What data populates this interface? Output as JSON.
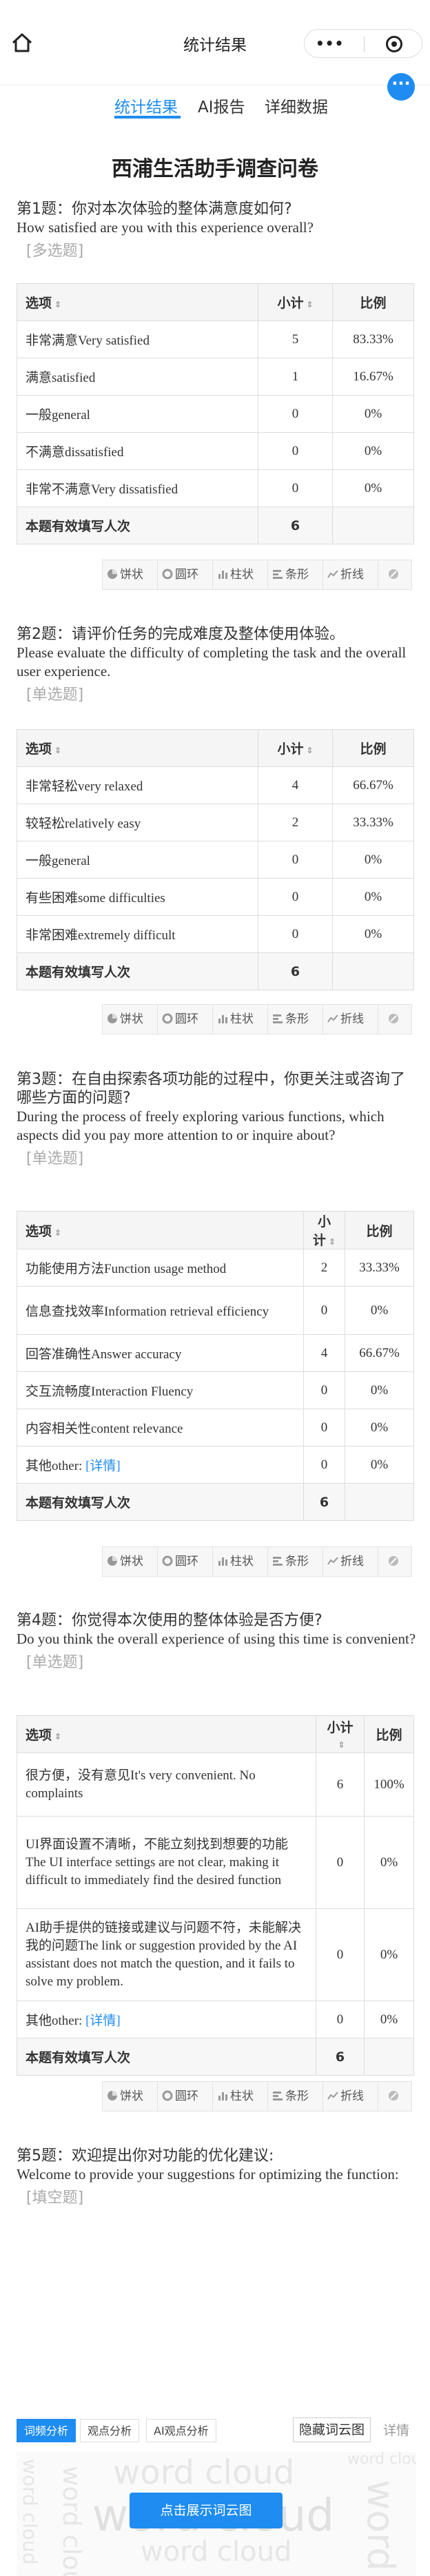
{
  "window": {
    "title": "统计结果",
    "capsule_menu": "•••",
    "capsule_close_icon": "record-icon"
  },
  "tabs": [
    {
      "label": "统计结果",
      "active": true
    },
    {
      "label": "AI报告"
    },
    {
      "label": "详细数据"
    }
  ],
  "accent": "#1e8cf0",
  "survey_title": "西浦生活助手调查问卷",
  "table_headers": {
    "option": "选项",
    "count": "小计",
    "ratio": "比例"
  },
  "total_label": "本题有效填写人次",
  "chart_tools": [
    "饼状",
    "圆环",
    "柱状",
    "条形",
    "折线"
  ],
  "questions": [
    {
      "title": "第1题：你对本次体验的整体满意度如何?",
      "title_en": "How satisfied are you with this experience overall?",
      "type": "[多选题]",
      "rows": [
        {
          "option": "非常满意Very satisfied",
          "count": "5",
          "ratio": "83.33%"
        },
        {
          "option": "满意satisfied",
          "count": "1",
          "ratio": "16.67%"
        },
        {
          "option": "一般general",
          "count": "0",
          "ratio": "0%"
        },
        {
          "option": "不满意dissatisfied",
          "count": "0",
          "ratio": "0%"
        },
        {
          "option": "非常不满意Very dissatisfied",
          "count": "0",
          "ratio": "0%"
        }
      ],
      "total": "6"
    },
    {
      "title": "第2题：请评价任务的完成难度及整体使用体验。",
      "title_en": "Please evaluate the difficulty of completing the task and the overall user experience.",
      "type": "[单选题]",
      "rows": [
        {
          "option": "非常轻松very relaxed",
          "count": "4",
          "ratio": "66.67%"
        },
        {
          "option": "较轻松relatively easy",
          "count": "2",
          "ratio": "33.33%"
        },
        {
          "option": "一般general",
          "count": "0",
          "ratio": "0%"
        },
        {
          "option": "有些困难some difficulties",
          "count": "0",
          "ratio": "0%"
        },
        {
          "option": "非常困难extremely difficult",
          "count": "0",
          "ratio": "0%"
        }
      ],
      "total": "6"
    },
    {
      "title": "第3题：在自由探索各项功能的过程中，你更关注或咨询了哪些方面的问题?",
      "title_en": "During the process of freely exploring various functions, which aspects did you pay more attention to or inquire about?",
      "type": "[单选题]",
      "rows": [
        {
          "option": "功能使用方法Function usage method",
          "count": "2",
          "ratio": "33.33%"
        },
        {
          "option": "信息查找效率Information retrieval efficiency",
          "count": "0",
          "ratio": "0%"
        },
        {
          "option": "回答准确性Answer accuracy",
          "count": "4",
          "ratio": "66.67%"
        },
        {
          "option": "交互流畅度Interaction Fluency",
          "count": "0",
          "ratio": "0%"
        },
        {
          "option": "内容相关性content relevance",
          "count": "0",
          "ratio": "0%"
        },
        {
          "option": "其他other:",
          "link": "[详情]",
          "count": "0",
          "ratio": "0%"
        }
      ],
      "total": "6"
    },
    {
      "title": "第4题：你觉得本次使用的整体体验是否方便?",
      "title_en": "Do you think the overall experience of using this time is convenient?",
      "type": "[单选题]",
      "rows": [
        {
          "option": "很方便，没有意见It's very convenient. No complaints",
          "count": "6",
          "ratio": "100%"
        },
        {
          "option": "UI界面设置不清晰，不能立刻找到想要的功能The UI interface settings are not clear, making it difficult to immediately find the desired function",
          "count": "0",
          "ratio": "0%"
        },
        {
          "option": "AI助手提供的链接或建议与问题不符，未能解决我的问题The link or suggestion provided by the AI assistant does not match the question, and it fails to solve my problem.",
          "count": "0",
          "ratio": "0%"
        },
        {
          "option": "其他other:",
          "link": "[详情]",
          "count": "0",
          "ratio": "0%"
        }
      ],
      "total": "6"
    }
  ],
  "q5": {
    "title": "第5题：欢迎提出你对功能的优化建议:",
    "title_en": "Welcome to provide your suggestions for optimizing the function:",
    "type": "[填空题]",
    "buttons": [
      "词频分析",
      "观点分析",
      "AI观点分析"
    ],
    "hide_label": "隐藏词云图",
    "detail_label": "详情",
    "cloud_button": "点击展示词云图",
    "cloud_words": [
      "word cloud",
      "word cloud",
      "word cloud",
      "word cloud",
      "word cloud",
      "word cloud",
      "word cloud"
    ]
  }
}
